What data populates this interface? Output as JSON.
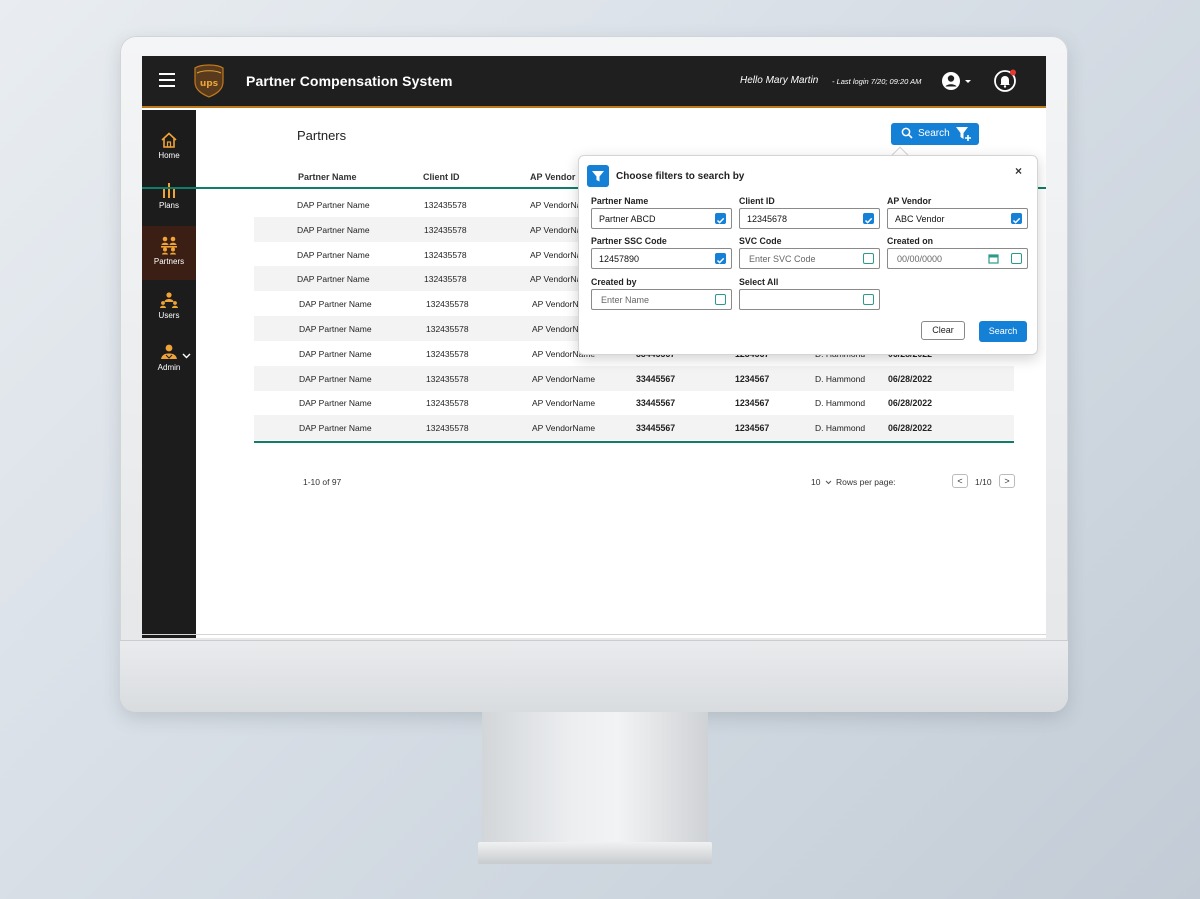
{
  "app": {
    "title": "Partner Compensation System",
    "greeting": "Hello Mary Martin",
    "last_login": "- Last login 7/20; 09:20 AM",
    "accent": "#c07a1c",
    "primary": "#1480d6",
    "table_rule": "#0f7d6a"
  },
  "sidebar": {
    "items": [
      {
        "label": "Home",
        "icon": "home-icon"
      },
      {
        "label": "Plans",
        "icon": "bar-chart-icon"
      },
      {
        "label": "Partners",
        "icon": "partners-icon"
      },
      {
        "label": "Users",
        "icon": "users-icon"
      },
      {
        "label": "Admin",
        "icon": "admin-icon"
      }
    ],
    "active": "Partners"
  },
  "page": {
    "title": "Partners",
    "search_button": "Search"
  },
  "table": {
    "columns": [
      "Partner Name",
      "Client ID",
      "AP Vendor"
    ],
    "rows": [
      [
        "DAP Partner Name",
        "132435578",
        "AP VendorName",
        "",
        "",
        "",
        ""
      ],
      [
        "DAP Partner Name",
        "132435578",
        "AP VendorName",
        "",
        "",
        "",
        ""
      ],
      [
        "DAP Partner Name",
        "132435578",
        "AP VendorName",
        "",
        "",
        "",
        ""
      ],
      [
        "DAP Partner Name",
        "132435578",
        "AP VendorName",
        "",
        "",
        "",
        ""
      ],
      [
        "DAP Partner Name",
        "132435578",
        "AP VendorName",
        "",
        "",
        "",
        ""
      ],
      [
        "DAP Partner Name",
        "132435578",
        "AP VendorName",
        "",
        "",
        "",
        ""
      ],
      [
        "DAP Partner Name",
        "132435578",
        "AP VendorName",
        "33445567",
        "1234567",
        "D. Hammond",
        "06/28/2022"
      ],
      [
        "DAP Partner Name",
        "132435578",
        "AP VendorName",
        "33445567",
        "1234567",
        "D. Hammond",
        "06/28/2022"
      ],
      [
        "DAP Partner Name",
        "132435578",
        "AP VendorName",
        "33445567",
        "1234567",
        "D. Hammond",
        "06/28/2022"
      ],
      [
        "DAP Partner Name",
        "132435578",
        "AP VendorName",
        "33445567",
        "1234567",
        "D. Hammond",
        "06/28/2022"
      ]
    ]
  },
  "pagination": {
    "range": "1-10 of 97",
    "rows_per_page_value": "10",
    "rows_per_page_label": "Rows per page:",
    "prev": "<",
    "page": "1/10",
    "next": ">"
  },
  "filter": {
    "title": "Choose filters to search by",
    "close": "×",
    "fields": [
      {
        "label": "Partner Name",
        "value": "Partner ABCD",
        "placeholder": "",
        "checked": true
      },
      {
        "label": "Client ID",
        "value": "12345678",
        "placeholder": "",
        "checked": true
      },
      {
        "label": "AP Vendor",
        "value": "ABC Vendor",
        "placeholder": "",
        "checked": true
      },
      {
        "label": "Partner SSC Code",
        "value": "12457890",
        "placeholder": "",
        "checked": true
      },
      {
        "label": "SVC Code",
        "value": "",
        "placeholder": "Enter SVC Code",
        "checked": false
      },
      {
        "label": "Created on",
        "value": "",
        "placeholder": "00/00/0000",
        "checked": false
      },
      {
        "label": "Created by",
        "value": "",
        "placeholder": "Enter Name",
        "checked": false
      },
      {
        "label": "Select All",
        "value": "",
        "placeholder": "",
        "checked": false
      }
    ],
    "clear_label": "Clear",
    "search_label": "Search"
  }
}
